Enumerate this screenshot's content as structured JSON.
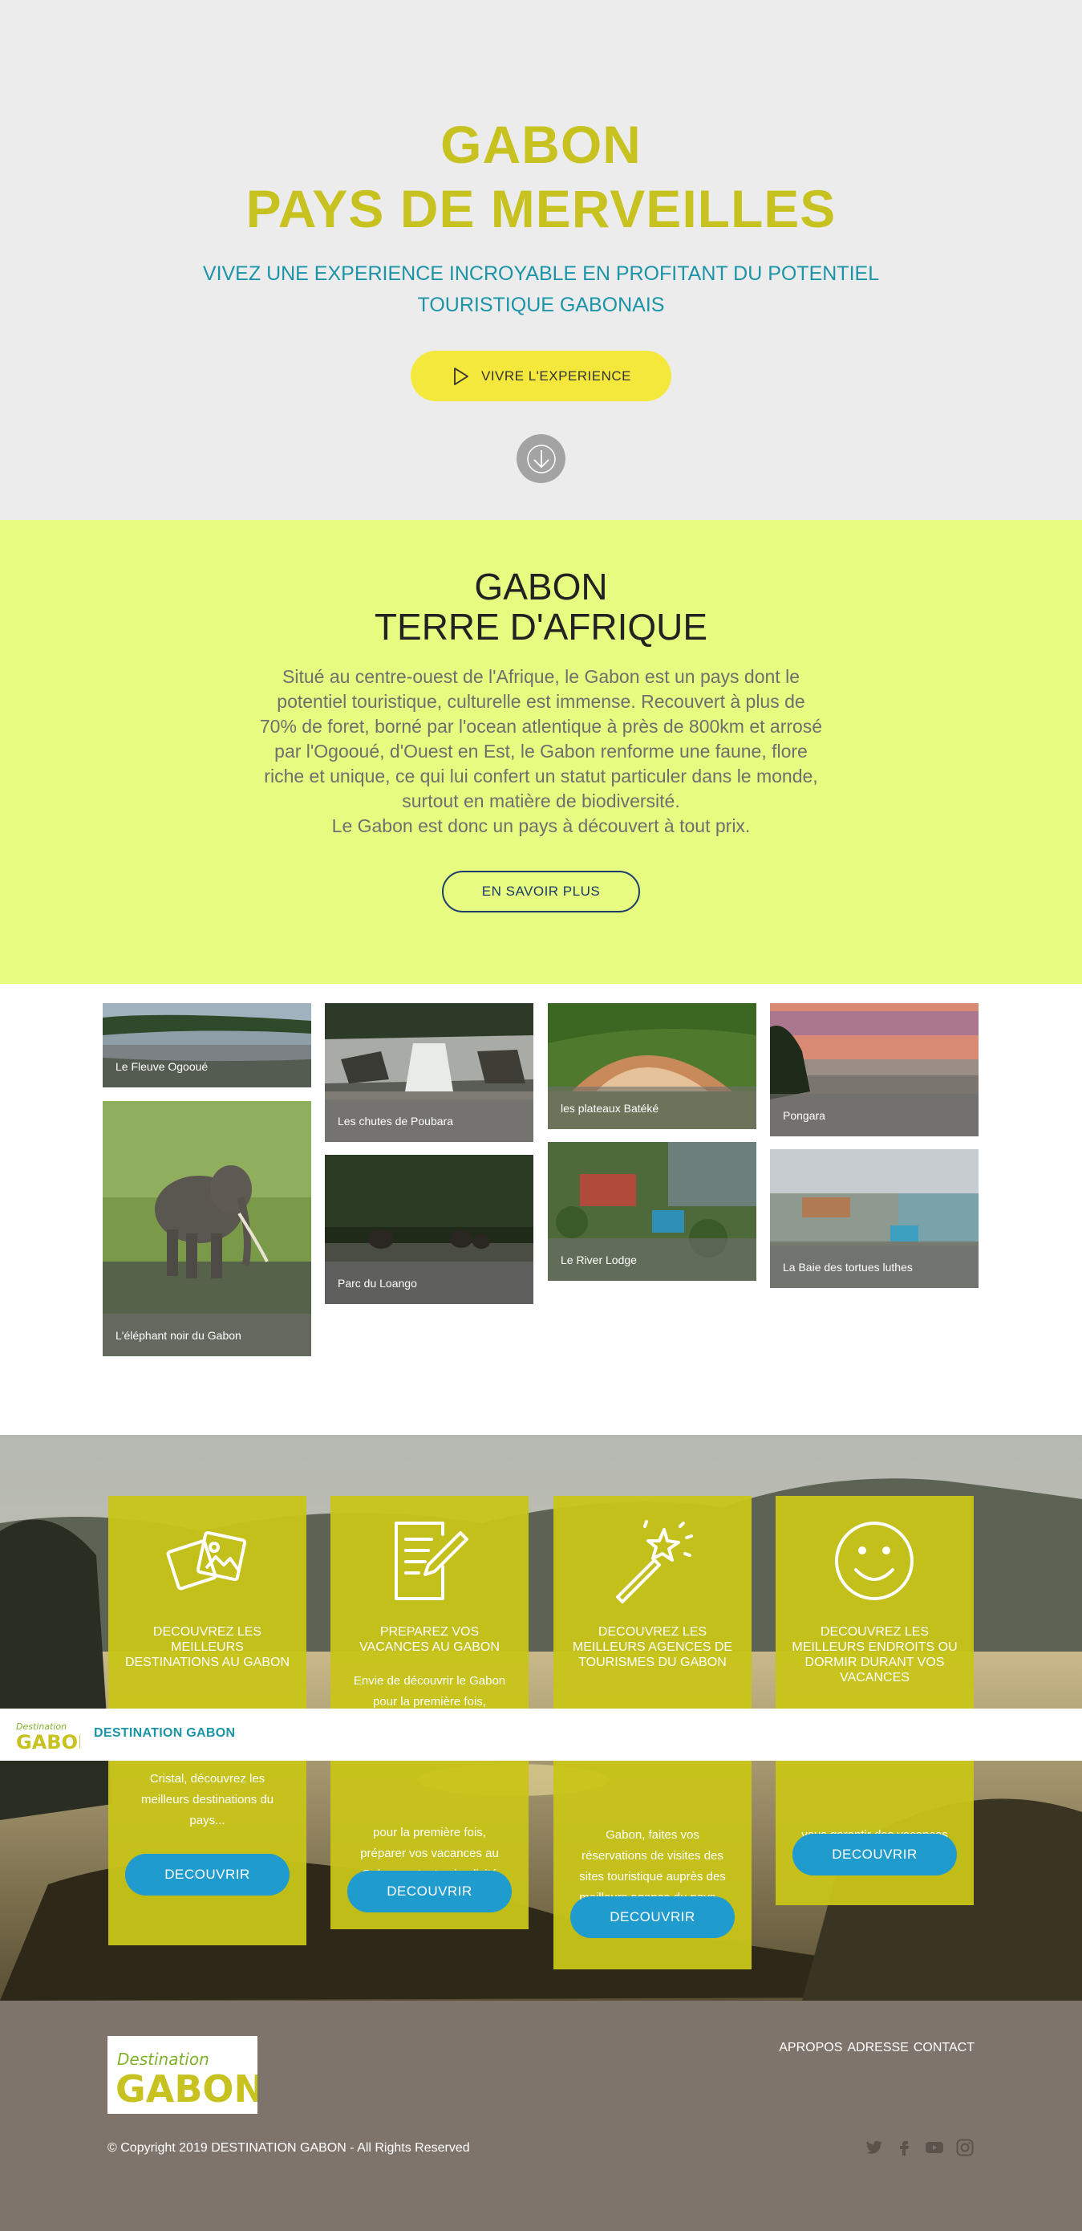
{
  "hero": {
    "title_line1": "GABON",
    "title_line2": "PAYS DE MERVEILLES",
    "subtitle_line1": "VIVEZ UNE EXPERIENCE INCROYABLE EN PROFITANT DU POTENTIEL",
    "subtitle_line2": "TOURISTIQUE GABONAIS",
    "cta_label": "VIVRE L'EXPERIENCE"
  },
  "about": {
    "title_line1": "GABON",
    "title_line2": "TERRE D'AFRIQUE",
    "paragraph": "Situé au centre-ouest de l'Afrique, le Gabon est un pays dont le potentiel touristique, culturelle est immense. Recouvert à plus de 70% de foret, borné par l'ocean atlentique à près de 800km et arrosé par l'Ogooué, d'Ouest en Est, le Gabon renforme une faune, flore riche et unique, ce qui lui confert un statut particuler dans le monde, surtout en matière de biodiversité.",
    "paragraph_end": "Le Gabon est donc un pays à découvert à tout prix.",
    "button_label": "EN SAVOIR PLUS"
  },
  "gallery": {
    "fleuve": "Le Fleuve Ogooué",
    "elephant": "L'éléphant noir du Gabon",
    "chutes": "Les chutes de Poubara",
    "loango": "Parc du Loango",
    "plateaux": "les plateaux Batéké",
    "lodge": "Le River Lodge",
    "pongara": "Pongara",
    "baie": "La Baie des tortues luthes"
  },
  "services": {
    "cards": [
      {
        "title": "DECOUVREZ LES MEILLEURS DESTINATIONS AU GABON",
        "text": "Cristal, découvrez les meilleurs destinations du pays...",
        "button": "DECOUVRIR"
      },
      {
        "title": "PREPAREZ VOS VACANCES AU GABON",
        "text_top": "Envie de découvrir le Gabon pour la première fois,",
        "text": "pour la première fois, préparer vos vacances au Gabon en toute simplicité",
        "button": "DECOUVRIR"
      },
      {
        "title": "DECOUVREZ LES MEILLEURS AGENCES DE TOURISMES DU GABON",
        "text": "Gabon, faites vos réservations de visites des sites touristique auprès des meilleurs agance du pays...",
        "button": "DECOUVRIR"
      },
      {
        "title": "DECOUVREZ LES MEILLEURS ENDROITS OU DORMIR DURANT VOS VACANCES",
        "text": "vous garantir des vacances de reves...",
        "button": "DECOUVRIR"
      }
    ]
  },
  "sticky_bar": {
    "logo_small": "Destination",
    "logo_big": "GABON",
    "brand": "DESTINATION GABON"
  },
  "footer": {
    "logo_small": "Destination",
    "logo_big": "GABON",
    "links": [
      "APROPOS",
      "ADRESSE",
      "CONTACT"
    ],
    "copyright": "© Copyright 2019 DESTINATION GABON - All Rights Reserved",
    "social_icons": [
      "twitter-icon",
      "facebook-icon",
      "youtube-icon",
      "instagram-icon"
    ]
  },
  "colors": {
    "hero_bg": "#ececec",
    "accent_olive": "#c8c220",
    "teal": "#1b94a8",
    "cta_yellow": "#f5e83c",
    "about_bg": "#e6fb7f",
    "card_olive": "#c8c418",
    "button_blue": "#1f9bcd",
    "footer_bg": "#7f746b"
  }
}
